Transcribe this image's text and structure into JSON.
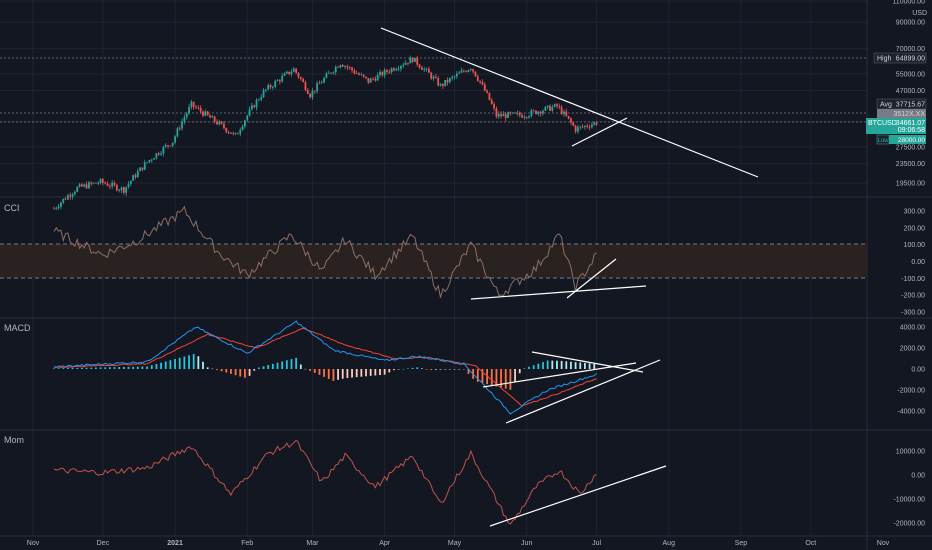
{
  "colors": {
    "background": "#131722",
    "grid": "#1f2430",
    "axis_text": "#b2b5be",
    "separator": "#2a2e39",
    "candle_up": "#26a69a",
    "candle_down": "#ef5350",
    "cci_line": "#8d6e63",
    "cci_band_fill": "#2a2220",
    "macd_line": "#2196f3",
    "signal_line": "#f44336",
    "hist_pos": "#26c6da",
    "hist_neg": "#ff7043",
    "mom_line": "#c0524c",
    "trendline": "#ffffff",
    "label_bg": "#1e222d",
    "price_label_bg": "#26a69a"
  },
  "main_pane": {
    "currency_label": "USD",
    "price_axis_labels": [
      "110000.00",
      "90000.00",
      "70000.00",
      "55000.00",
      "47000.00",
      "35000.00",
      "27500.00",
      "23500.00",
      "19500.00"
    ],
    "high_label": {
      "name": "High",
      "value": "64899.00"
    },
    "avg_label": {
      "name": "Avg",
      "value": "37715.67"
    },
    "current_label": {
      "symbol": "BTCUSD",
      "price": "34661.07",
      "countdown": "09:06:58"
    },
    "masked_label_1": "3512X.XX",
    "masked_label_2": "3XXXX.XX",
    "low_badge": "Low",
    "low_value": "28000.00"
  },
  "cci_pane": {
    "name": "CCI",
    "axis_labels": [
      "300.00",
      "200.00",
      "100.00",
      "0.00",
      "-100.00",
      "-200.00",
      "-300.00"
    ]
  },
  "macd_pane": {
    "name": "MACD",
    "axis_labels": [
      "4000.00",
      "2000.00",
      "0.00",
      "-2000.00",
      "-4000.00"
    ]
  },
  "mom_pane": {
    "name": "Mom",
    "axis_labels": [
      "10000.00",
      "0.00",
      "-10000.00",
      "-20000.00"
    ]
  },
  "time_axis": [
    "Nov",
    "Dec",
    "2021",
    "Feb",
    "Mar",
    "Apr",
    "May",
    "Jun",
    "Jul",
    "Aug",
    "Sep",
    "Oct",
    "Nov"
  ],
  "chart_data": [
    {
      "type": "candlestick",
      "title": "BTCUSD",
      "y_scale": "log",
      "ylim": [
        17000,
        110000
      ],
      "x_start": "2020-11-10",
      "x_end": "2021-07-01",
      "interval": "daily",
      "close_approx": [
        [
          "2020-11-10",
          15300
        ],
        [
          "2020-11-20",
          18600
        ],
        [
          "2020-11-30",
          19700
        ],
        [
          "2020-12-10",
          18300
        ],
        [
          "2020-12-20",
          23800
        ],
        [
          "2020-12-31",
          29000
        ],
        [
          "2021-01-08",
          41000
        ],
        [
          "2021-01-15",
          36800
        ],
        [
          "2021-01-27",
          30400
        ],
        [
          "2021-02-08",
          46400
        ],
        [
          "2021-02-21",
          57500
        ],
        [
          "2021-02-28",
          45200
        ],
        [
          "2021-03-13",
          61200
        ],
        [
          "2021-03-25",
          51300
        ],
        [
          "2021-04-13",
          63500
        ],
        [
          "2021-04-25",
          49100
        ],
        [
          "2021-05-08",
          58800
        ],
        [
          "2021-05-19",
          37000
        ],
        [
          "2021-05-31",
          37300
        ],
        [
          "2021-06-14",
          40500
        ],
        [
          "2021-06-22",
          32500
        ],
        [
          "2021-07-01",
          34661
        ]
      ],
      "high": 64899,
      "average": 37715.67,
      "last": 34661.07,
      "annotations": [
        "descending trendline from Apr high extending to Sep",
        "short rising support line in Jun"
      ]
    },
    {
      "type": "line",
      "title": "CCI",
      "ylim": [
        -300,
        300
      ],
      "bands": [
        100,
        -100
      ],
      "values_approx": [
        [
          "2020-11-10",
          180
        ],
        [
          "2020-12-01",
          40
        ],
        [
          "2020-12-15",
          120
        ],
        [
          "2021-01-05",
          300
        ],
        [
          "2021-01-20",
          50
        ],
        [
          "2021-02-01",
          -80
        ],
        [
          "2021-02-20",
          160
        ],
        [
          "2021-03-05",
          -60
        ],
        [
          "2021-03-15",
          130
        ],
        [
          "2021-03-28",
          -80
        ],
        [
          "2021-04-13",
          150
        ],
        [
          "2021-04-25",
          -200
        ],
        [
          "2021-05-08",
          100
        ],
        [
          "2021-05-20",
          -200
        ],
        [
          "2021-06-05",
          -40
        ],
        [
          "2021-06-15",
          160
        ],
        [
          "2021-06-22",
          -150
        ],
        [
          "2021-07-01",
          40
        ]
      ]
    },
    {
      "type": "macd",
      "title": "MACD",
      "ylim": [
        -4500,
        4500
      ],
      "series": [
        {
          "name": "MACD",
          "values_approx": [
            [
              "2020-11-10",
              200
            ],
            [
              "2020-12-20",
              700
            ],
            [
              "2021-01-10",
              4000
            ],
            [
              "2021-02-01",
              1500
            ],
            [
              "2021-02-22",
              4500
            ],
            [
              "2021-03-10",
              1800
            ],
            [
              "2021-04-01",
              800
            ],
            [
              "2021-04-15",
              1200
            ],
            [
              "2021-05-05",
              500
            ],
            [
              "2021-05-25",
              -4200
            ],
            [
              "2021-06-10",
              -2000
            ],
            [
              "2021-07-01",
              -500
            ]
          ]
        },
        {
          "name": "Signal",
          "values_approx": [
            [
              "2020-11-10",
              150
            ],
            [
              "2020-12-20",
              500
            ],
            [
              "2021-01-15",
              3300
            ],
            [
              "2021-02-05",
              2000
            ],
            [
              "2021-02-25",
              3900
            ],
            [
              "2021-03-15",
              2300
            ],
            [
              "2021-04-05",
              1000
            ],
            [
              "2021-04-20",
              1100
            ],
            [
              "2021-05-10",
              300
            ],
            [
              "2021-05-30",
              -3500
            ],
            [
              "2021-06-15",
              -2300
            ],
            [
              "2021-07-01",
              -900
            ]
          ]
        }
      ]
    },
    {
      "type": "line",
      "title": "Mom",
      "ylim": [
        -22000,
        16000
      ],
      "values_approx": [
        [
          "2020-11-10",
          2000
        ],
        [
          "2020-12-01",
          1000
        ],
        [
          "2020-12-20",
          3000
        ],
        [
          "2021-01-08",
          12000
        ],
        [
          "2021-01-25",
          -8000
        ],
        [
          "2021-02-10",
          9000
        ],
        [
          "2021-02-22",
          14000
        ],
        [
          "2021-03-05",
          -3000
        ],
        [
          "2021-03-15",
          8000
        ],
        [
          "2021-03-28",
          -5000
        ],
        [
          "2021-04-13",
          8000
        ],
        [
          "2021-04-25",
          -12000
        ],
        [
          "2021-05-08",
          9000
        ],
        [
          "2021-05-25",
          -21000
        ],
        [
          "2021-06-05",
          -5000
        ],
        [
          "2021-06-15",
          2000
        ],
        [
          "2021-06-24",
          -8000
        ],
        [
          "2021-07-01",
          1000
        ]
      ]
    }
  ]
}
